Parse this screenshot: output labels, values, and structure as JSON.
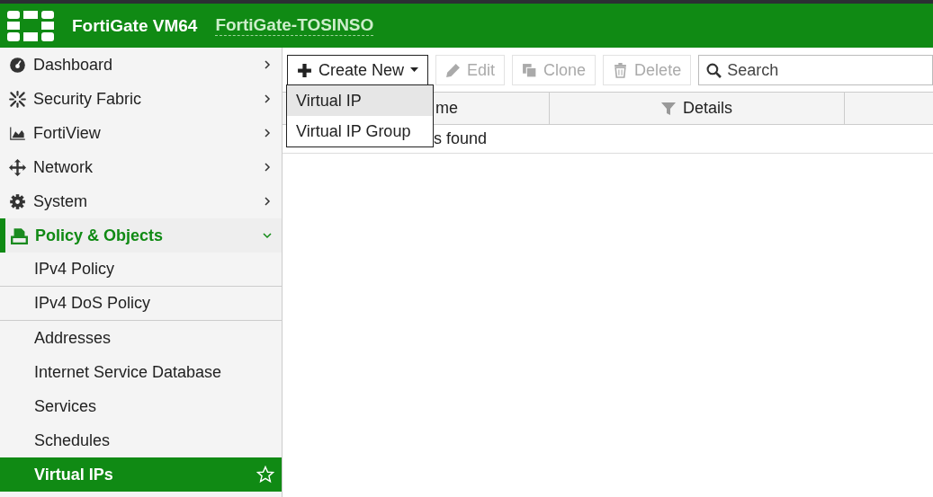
{
  "header": {
    "product": "FortiGate VM64",
    "hostname": "FortiGate-TOSINSO"
  },
  "sidebar": {
    "items": [
      {
        "label": "Dashboard",
        "expanded": false
      },
      {
        "label": "Security Fabric",
        "expanded": false
      },
      {
        "label": "FortiView",
        "expanded": false
      },
      {
        "label": "Network",
        "expanded": false
      },
      {
        "label": "System",
        "expanded": false
      },
      {
        "label": "Policy & Objects",
        "expanded": true,
        "children": [
          {
            "label": "IPv4 Policy",
            "selected": false
          },
          {
            "label": "IPv4 DoS Policy",
            "selected": false
          },
          {
            "label": "Addresses",
            "selected": false
          },
          {
            "label": "Internet Service Database",
            "selected": false
          },
          {
            "label": "Services",
            "selected": false
          },
          {
            "label": "Schedules",
            "selected": false
          },
          {
            "label": "Virtual IPs",
            "selected": true
          }
        ]
      }
    ]
  },
  "toolbar": {
    "buttons": [
      {
        "label": "Create New",
        "disabled": false
      },
      {
        "label": "Edit",
        "disabled": true
      },
      {
        "label": "Clone",
        "disabled": true
      },
      {
        "label": "Delete",
        "disabled": true
      }
    ],
    "search": {
      "placeholder": "Search"
    }
  },
  "menu": {
    "items": [
      {
        "label": "Virtual IP",
        "selected": true
      },
      {
        "label": "Virtual IP Group",
        "selected": false
      }
    ]
  },
  "table": {
    "columns": [
      "me",
      "Details"
    ],
    "empty_text": "s found"
  }
}
